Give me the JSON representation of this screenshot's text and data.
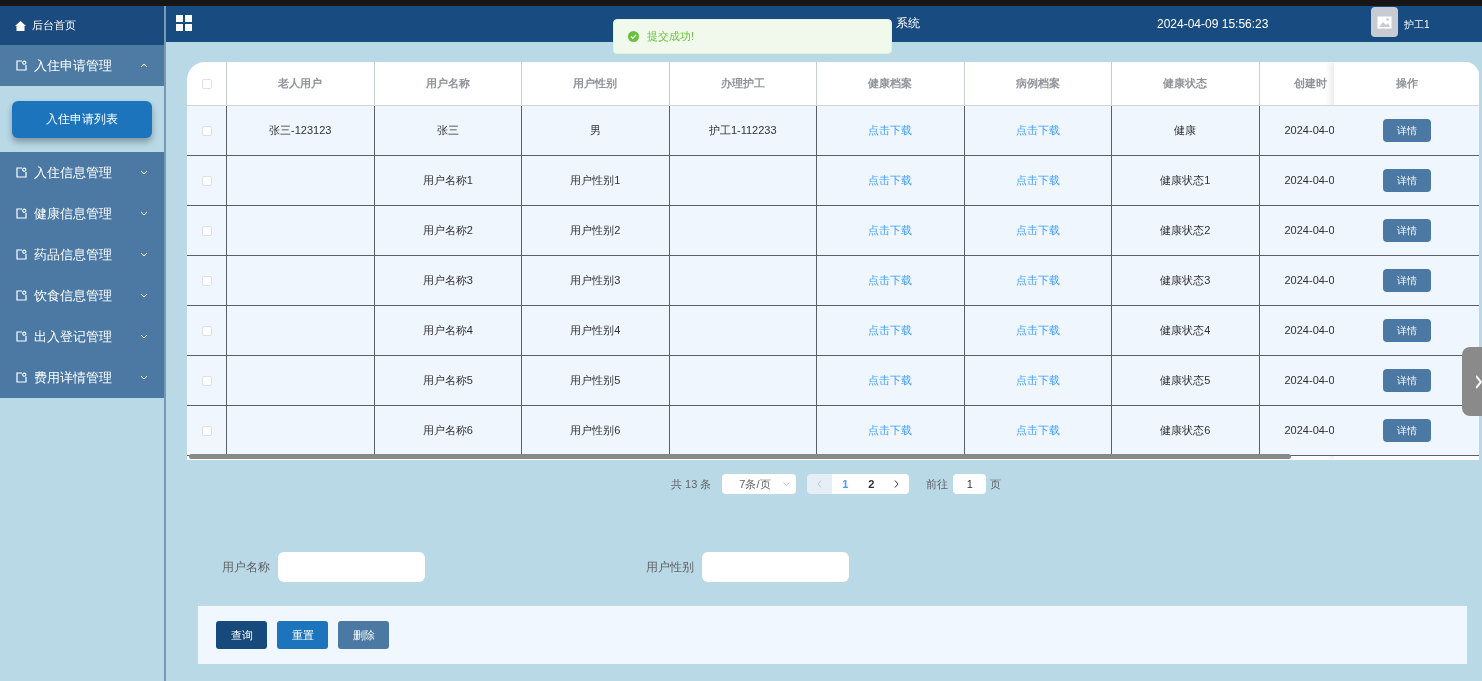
{
  "sidebar": {
    "home": "后台首页",
    "menus": [
      {
        "label": "入住申请管理",
        "expanded": true,
        "children": [
          {
            "label": "入住申请列表",
            "selected": true
          }
        ]
      },
      {
        "label": "入住信息管理",
        "expanded": false
      },
      {
        "label": "健康信息管理",
        "expanded": false
      },
      {
        "label": "药品信息管理",
        "expanded": false
      },
      {
        "label": "饮食信息管理",
        "expanded": false
      },
      {
        "label": "出入登记管理",
        "expanded": false
      },
      {
        "label": "费用详情管理",
        "expanded": false
      }
    ]
  },
  "header": {
    "title": "系统",
    "datetime": "2024-04-09 15:56:23",
    "user": "护工1"
  },
  "toast": {
    "message": "提交成功!"
  },
  "table": {
    "columns": [
      "老人用户",
      "用户名称",
      "用户性别",
      "办理护工",
      "健康档案",
      "病例档案",
      "健康状态",
      "创建时"
    ],
    "action_column": "操作",
    "select_all_checked": false,
    "rows": [
      {
        "checked": false,
        "elder_user": "张三-123123",
        "user_name": "张三",
        "gender": "男",
        "nurse": "护工1-112233",
        "health_record": "点击下载",
        "case_record": "点击下载",
        "health_status": "健康",
        "created": "2024-04-0",
        "action": "详情"
      },
      {
        "checked": false,
        "user_name": "用户名称1",
        "gender": "用户性别1",
        "health_record": "点击下载",
        "case_record": "点击下载",
        "health_status": "健康状态1",
        "created": "2024-04-0",
        "action": "详情"
      },
      {
        "checked": false,
        "user_name": "用户名称2",
        "gender": "用户性别2",
        "health_record": "点击下载",
        "case_record": "点击下载",
        "health_status": "健康状态2",
        "created": "2024-04-0",
        "action": "详情"
      },
      {
        "checked": false,
        "user_name": "用户名称3",
        "gender": "用户性别3",
        "health_record": "点击下载",
        "case_record": "点击下载",
        "health_status": "健康状态3",
        "created": "2024-04-0",
        "action": "详情"
      },
      {
        "checked": false,
        "user_name": "用户名称4",
        "gender": "用户性别4",
        "health_record": "点击下载",
        "case_record": "点击下载",
        "health_status": "健康状态4",
        "created": "2024-04-0",
        "action": "详情"
      },
      {
        "checked": false,
        "user_name": "用户名称5",
        "gender": "用户性别5",
        "health_record": "点击下载",
        "case_record": "点击下载",
        "health_status": "健康状态5",
        "created": "2024-04-0",
        "action": "详情"
      },
      {
        "checked": false,
        "user_name": "用户名称6",
        "gender": "用户性别6",
        "health_record": "点击下载",
        "case_record": "点击下载",
        "health_status": "健康状态6",
        "created": "2024-04-0",
        "action": "详情"
      }
    ]
  },
  "pagination": {
    "total": "共 13 条",
    "page_size": "7条/页",
    "prev_disabled": true,
    "pages": [
      {
        "label": "1",
        "selected": true
      },
      {
        "label": "2",
        "selected": false
      }
    ],
    "goto_label": "前往",
    "goto_value": "1",
    "goto_suffix": "页"
  },
  "search": {
    "fields": [
      {
        "label": "用户名称"
      },
      {
        "label": "用户性别"
      }
    ],
    "buttons": [
      {
        "label": "查询",
        "kind": "query"
      },
      {
        "label": "重置",
        "kind": "reset"
      },
      {
        "label": "删除",
        "kind": "delete"
      }
    ]
  }
}
